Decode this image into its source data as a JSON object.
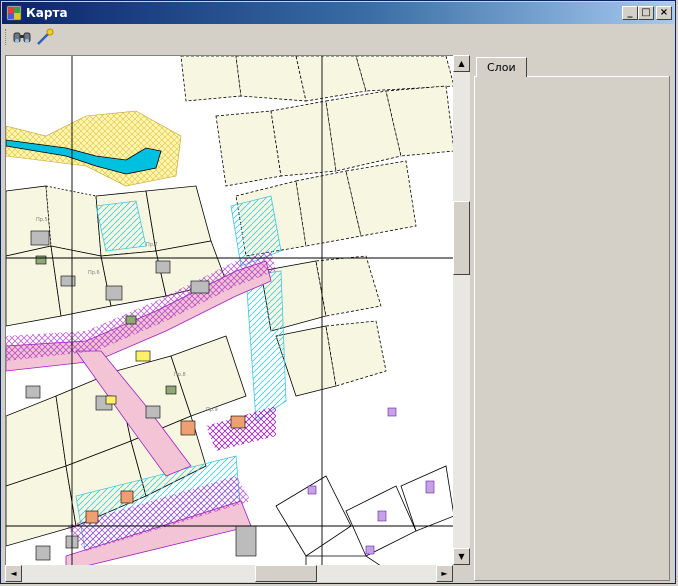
{
  "window": {
    "title": "Карта",
    "controls": {
      "minimize": "_",
      "maximize": "□",
      "close": "×"
    }
  },
  "toolbar": {
    "tools": [
      {
        "name": "binoculars-icon"
      },
      {
        "name": "magic-wand-icon"
      }
    ]
  },
  "scrollbar": {
    "up": "▲",
    "down": "▼",
    "left": "◄",
    "right": "►"
  },
  "layers_panel": {
    "tabs": [
      {
        "label": "Слои"
      }
    ]
  },
  "map": {
    "labels": [
      "Пр.5",
      "Пр.6",
      "Пр.7",
      "Пр.8",
      "Пр.9"
    ],
    "colors": {
      "parcel_fill": "#f7f7e1",
      "road_fill": "#f2c4d6",
      "hatch_magenta": "#a020c0",
      "hatch_cyan": "#40c8e0",
      "river": "#00c0e0",
      "sand": "#fff0a0",
      "building": "#bcbcbc",
      "house_orange": "#f0a070",
      "house_green": "#90a878",
      "grid_line": "#000000"
    }
  }
}
